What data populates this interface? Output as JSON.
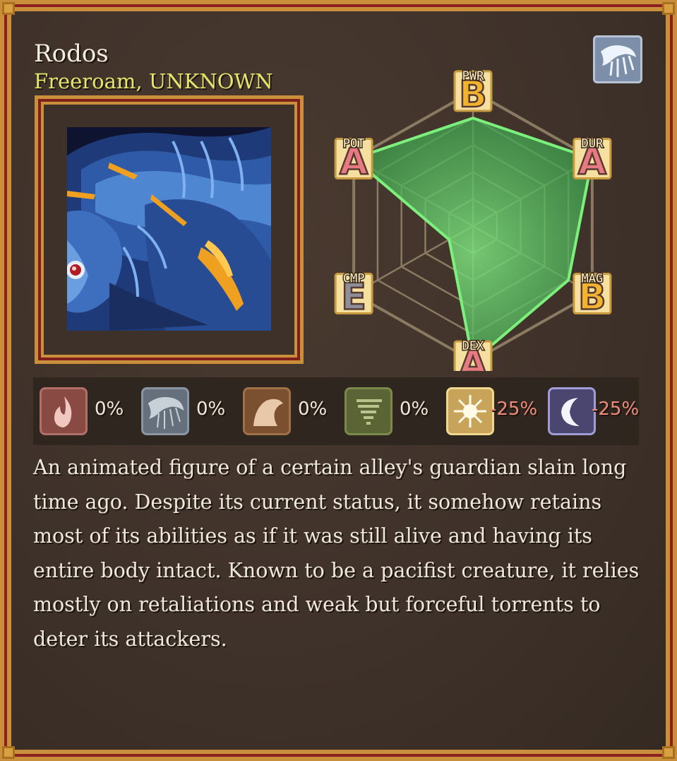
{
  "creature": {
    "name": "Rodos",
    "subtitle": "Freeroam, UNKNOWN",
    "element_icon": "water-torrent-icon",
    "description": "An animated figure of a certain alley's guardian slain long time ago. Despite its current status, it somehow retains most of its abilities as if it was still alive and having its entire body intact. Known to be a pacifist creature, it relies mostly on retaliations and weak but forceful torrents to deter its attackers."
  },
  "stats": [
    {
      "key": "PWR",
      "grade": "B",
      "value": 4
    },
    {
      "key": "DUR",
      "grade": "A",
      "value": 5
    },
    {
      "key": "MAG",
      "grade": "B",
      "value": 4
    },
    {
      "key": "DEX",
      "grade": "A",
      "value": 5
    },
    {
      "key": "CMP",
      "grade": "E",
      "value": 1
    },
    {
      "key": "POT",
      "grade": "A",
      "value": 5
    }
  ],
  "grade_colors": {
    "A": "#e87a84",
    "B": "#f2b32e",
    "E": "#8e8e98"
  },
  "resistances": [
    {
      "icon": "fire-icon",
      "value": "0%",
      "bg": "#8a4a44",
      "border": "#b07068"
    },
    {
      "icon": "water-icon",
      "value": "0%",
      "bg": "#65707c",
      "border": "#8a96a4"
    },
    {
      "icon": "earth-icon",
      "value": "0%",
      "bg": "#7a5030",
      "border": "#a07048"
    },
    {
      "icon": "wind-icon",
      "value": "0%",
      "bg": "#5a6434",
      "border": "#7a8a4c"
    },
    {
      "icon": "light-icon",
      "value": "-25%",
      "bg": "#c8a45a",
      "border": "#f0d890"
    },
    {
      "icon": "dark-icon",
      "value": "-25%",
      "bg": "#4a4670",
      "border": "#a09cd8"
    }
  ]
}
